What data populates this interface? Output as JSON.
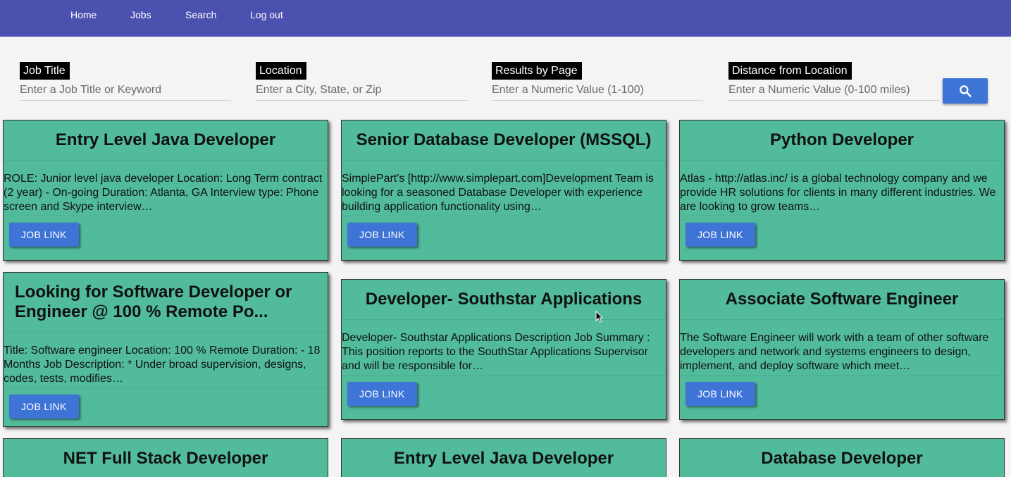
{
  "nav": {
    "items": [
      {
        "label": "Home"
      },
      {
        "label": "Jobs"
      },
      {
        "label": "Search"
      },
      {
        "label": "Log out"
      }
    ]
  },
  "search": {
    "fields": [
      {
        "label": "Job Title",
        "placeholder": "Enter a Job Title or Keyword"
      },
      {
        "label": "Location",
        "placeholder": "Enter a City, State, or Zip"
      },
      {
        "label": "Results by Page",
        "placeholder": "Enter a Numeric Value (1-100)"
      },
      {
        "label": "Distance from Location",
        "placeholder": "Enter a Numeric Value (0-100 miles)"
      }
    ],
    "button_icon": "search-icon"
  },
  "jobs": [
    {
      "title": "Entry Level Java Developer",
      "description": "ROLE: Junior level java developer Location: Long Term contract (2 year) - On-going Duration: Atlanta, GA Interview type: Phone screen and Skype interview…",
      "link_label": "JOB LINK"
    },
    {
      "title": "Senior Database Developer (MSSQL)",
      "description": "SimplePart's [http://www.simplepart.com]Development Team is looking for a seasoned Database Developer with experience building application functionality using…",
      "link_label": "JOB LINK"
    },
    {
      "title": "Python Developer",
      "description": "Atlas - http://atlas.inc/ is a global technology company and we provide HR solutions for clients in many different industries. We are looking to grow teams…",
      "link_label": "JOB LINK"
    },
    {
      "title": "Looking for Software Developer or Engineer @ 100 % Remote Po...",
      "description": "Title: Software engineer Location: 100 % Remote Duration: - 18 Months Job Description: * Under broad supervision, designs, codes, tests, modifies…",
      "link_label": "JOB LINK"
    },
    {
      "title": "Developer- Southstar Applications",
      "description": "Developer- Southstar Applications Description Job Summary : This position reports to the SouthStar Applications Supervisor and will be responsible for…",
      "link_label": "JOB LINK"
    },
    {
      "title": "Associate Software Engineer",
      "description": "The Software Engineer will work with a team of other software developers and network and systems engineers to design, implement, and deploy software which meet…",
      "link_label": "JOB LINK"
    },
    {
      "title": "NET Full Stack Developer"
    },
    {
      "title": "Entry Level Java Developer"
    },
    {
      "title": "Database Developer"
    }
  ],
  "colors": {
    "navbar": "#4a51ae",
    "card": "#51bb9c",
    "button": "#3f74d7"
  }
}
